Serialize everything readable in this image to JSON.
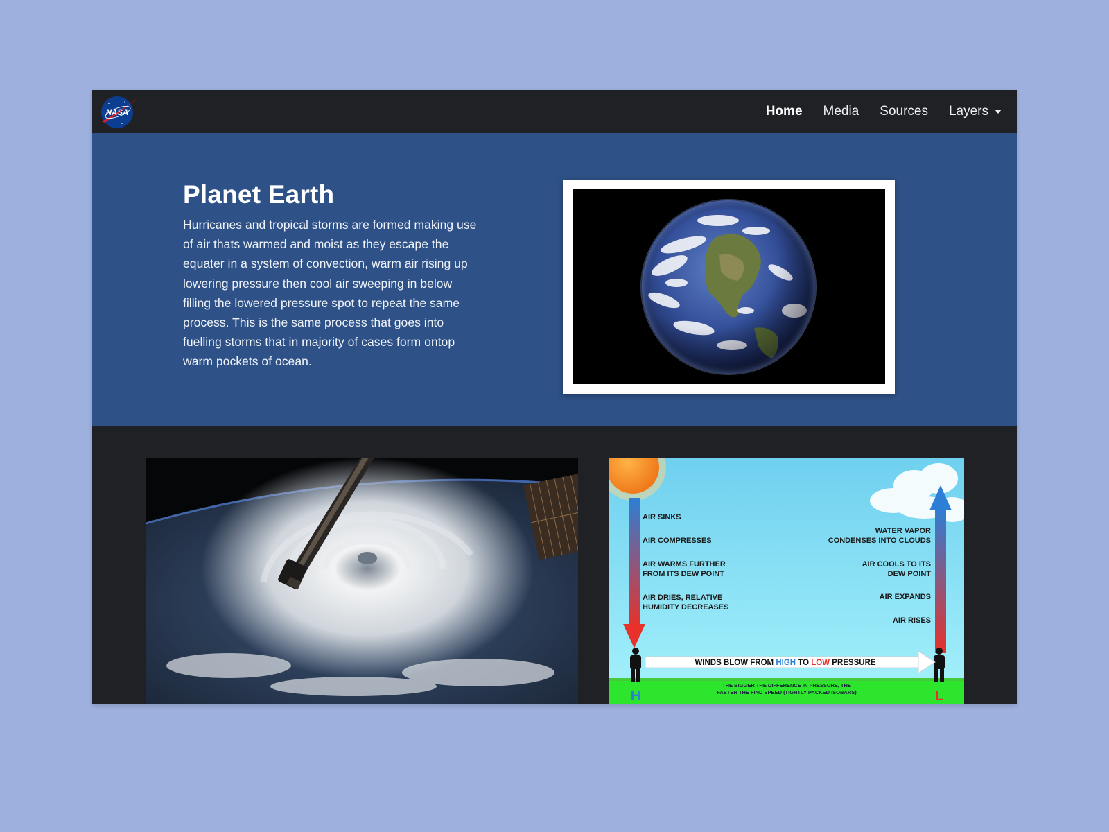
{
  "navbar": {
    "logo_text": "NASA",
    "links": [
      {
        "label": "Home"
      },
      {
        "label": "Media"
      },
      {
        "label": "Sources"
      },
      {
        "label": "Layers"
      }
    ]
  },
  "hero": {
    "title": "Planet Earth",
    "text": "Hurricanes and tropical storms are formed making use of air thats warmed and moist as they escape the equater in a system of convection, warm air rising up lowering pressure then cool air sweeping in below filling the lowered pressure spot to repeat the same process. This is the same process that goes into fuelling storms that in majority of cases form ontop warm pockets of ocean."
  },
  "diagram": {
    "left_labels": [
      [
        "AIR SINKS"
      ],
      [
        "AIR COMPRESSES"
      ],
      [
        "AIR WARMS FURTHER",
        "FROM ITS DEW POINT"
      ],
      [
        "AIR DRIES, RELATIVE",
        "HUMIDITY DECREASES"
      ]
    ],
    "right_labels": [
      [
        "WATER VAPOR",
        "CONDENSES INTO CLOUDS"
      ],
      [
        "AIR COOLS TO ITS",
        "DEW POINT"
      ],
      [
        "AIR EXPANDS"
      ],
      [
        "AIR RISES"
      ]
    ],
    "winds_prefix": "WINDS BLOW FROM ",
    "winds_high": "HIGH",
    "winds_mid": " TO ",
    "winds_low": "LOW",
    "winds_suffix": " PRESSURE",
    "footer_line1": "THE BIGGER THE DIFFERENCE IN PRESSURE, THE",
    "footer_line2": "FASTER THE FIND SPEED (TIGHTLY PACKED ISOBARS)",
    "high_letter": "H",
    "low_letter": "L",
    "colors": {
      "high": "#2d7fd6",
      "low": "#e8312a"
    }
  }
}
